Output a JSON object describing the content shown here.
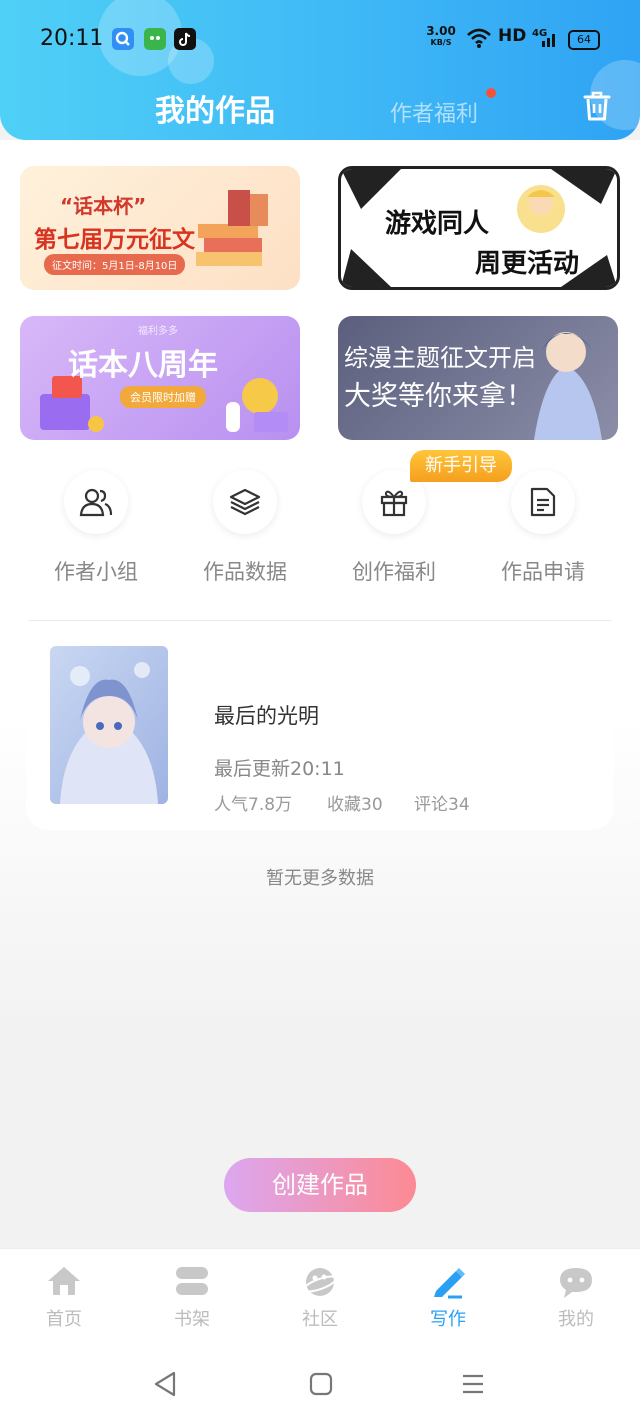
{
  "status": {
    "time": "20:11",
    "speed_value": "3.00",
    "speed_unit": "KB/S",
    "hd": "HD",
    "network": "4G",
    "battery": "64"
  },
  "header": {
    "title": "我的作品",
    "welfare": "作者福利"
  },
  "banners": [
    {
      "line1": "“话本杯”",
      "line2": "第七届万元征文",
      "line3": "征文时间：5月1日-8月10日"
    },
    {
      "line1": "游戏同人",
      "line2": "周更活动"
    },
    {
      "line1": "福利多多",
      "line2": "话本八周年",
      "line3": "会员限时加赠"
    },
    {
      "line1": "综漫主题征文开启",
      "line2": "大奖等你来拿！"
    }
  ],
  "quick_actions": [
    {
      "label": "作者小组",
      "icon": "people-icon"
    },
    {
      "label": "作品数据",
      "icon": "layers-icon"
    },
    {
      "label": "创作福利",
      "icon": "gift-icon"
    },
    {
      "label": "作品申请",
      "icon": "document-icon"
    }
  ],
  "guide_badge": "新手引导",
  "work": {
    "title": "最后的光明",
    "updated": "最后更新20:11",
    "popularity": "人气7.8万",
    "favorites": "收藏30",
    "comments": "评论34"
  },
  "no_more": "暂无更多数据",
  "create_button": "创建作品",
  "tabs": [
    {
      "label": "首页",
      "icon": "home-icon",
      "active": false
    },
    {
      "label": "书架",
      "icon": "bookshelf-icon",
      "active": false
    },
    {
      "label": "社区",
      "icon": "planet-icon",
      "active": false
    },
    {
      "label": "写作",
      "icon": "pen-icon",
      "active": true
    },
    {
      "label": "我的",
      "icon": "chat-bubble-icon",
      "active": false
    }
  ],
  "colors": {
    "header": "#3fb8f6",
    "active_tab": "#2aa0f5",
    "badge": "#f4533a",
    "guide": "#f7a823"
  }
}
